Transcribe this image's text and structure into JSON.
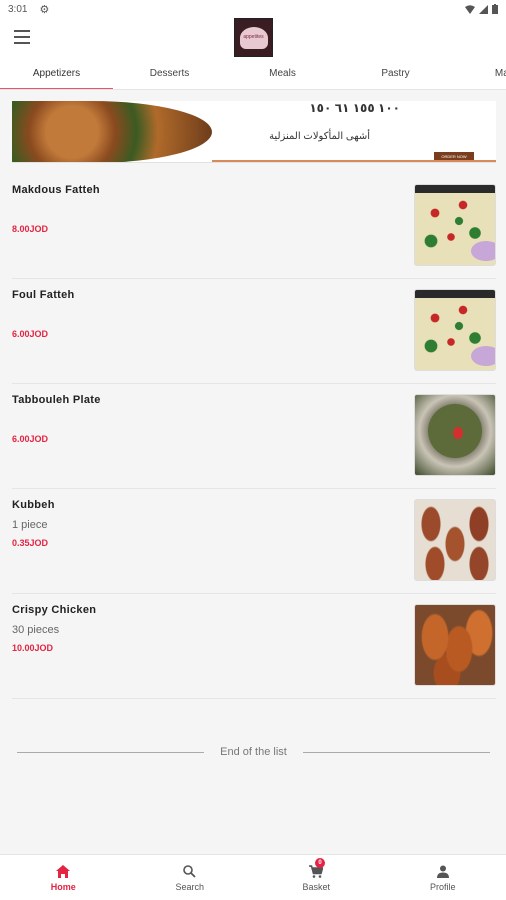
{
  "status": {
    "time": "3:01"
  },
  "app": {
    "logo_text": "appetites"
  },
  "tabs": [
    {
      "label": "Appetizers",
      "active": true
    },
    {
      "label": "Desserts"
    },
    {
      "label": "Meals"
    },
    {
      "label": "Pastry"
    },
    {
      "label": "Main I"
    }
  ],
  "banner": {
    "headline": "١٠٠ ١٥٥ ٦١ ١٥٠",
    "tagline": "أشهى المأكولات المنزلية",
    "button": "ORDER NOW"
  },
  "items": [
    {
      "name": "Makdous Fatteh",
      "desc": "",
      "price": "8.00JOD",
      "image": "fatteh-plate"
    },
    {
      "name": "Foul Fatteh",
      "desc": "",
      "price": "6.00JOD",
      "image": "fatteh-plate"
    },
    {
      "name": "Tabbouleh Plate",
      "desc": "",
      "price": "6.00JOD",
      "image": "tabbouleh-plate"
    },
    {
      "name": "Kubbeh",
      "desc": "1 piece",
      "price": "0.35JOD",
      "image": "kubbeh-plate"
    },
    {
      "name": "Crispy Chicken",
      "desc": "30 pieces",
      "price": "10.00JOD",
      "image": "crispy-chicken-plate"
    }
  ],
  "end_of_list": "End of the list",
  "bottom_nav": {
    "home": "Home",
    "search": "Search",
    "basket": "Basket",
    "basket_count": "0",
    "profile": "Profile"
  },
  "colors": {
    "accent": "#e32442",
    "tab_indicator": "#e8546a"
  }
}
